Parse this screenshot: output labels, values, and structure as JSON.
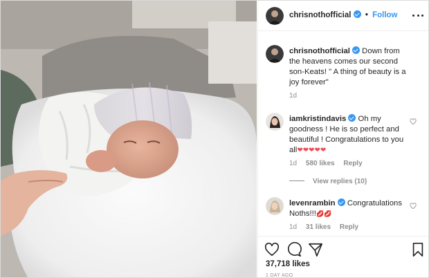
{
  "post": {
    "author": "chrisnothofficial",
    "follow_label": "Follow",
    "separator": "•",
    "caption_text": "Down from the heavens comes our second son-Keats! \" A thing of beauty is a joy forever\"",
    "caption_age": "1d",
    "likes_label": "37,718 likes",
    "time_label": "1 DAY AGO"
  },
  "comments": [
    {
      "user": "iamkristindavis",
      "text": "Oh my goodness ! He is so perfect and beautiful ! Congratulations to you all",
      "emoji": "❤❤❤❤❤",
      "age": "1d",
      "likes": "580 likes",
      "reply": "Reply",
      "view_replies": "View replies (10)"
    },
    {
      "user": "levenrambin",
      "text": "Congratulations Noths!!!",
      "emoji": "💋💋",
      "age": "1d",
      "likes": "31 likes",
      "reply": "Reply"
    }
  ],
  "colors": {
    "accent": "#3897f0",
    "text": "#262626",
    "muted": "#8e8e8e",
    "heart": "#ed4956"
  },
  "icons": [
    "like-icon",
    "comment-icon",
    "share-icon",
    "save-icon",
    "more-options-icon",
    "verified-icon"
  ]
}
